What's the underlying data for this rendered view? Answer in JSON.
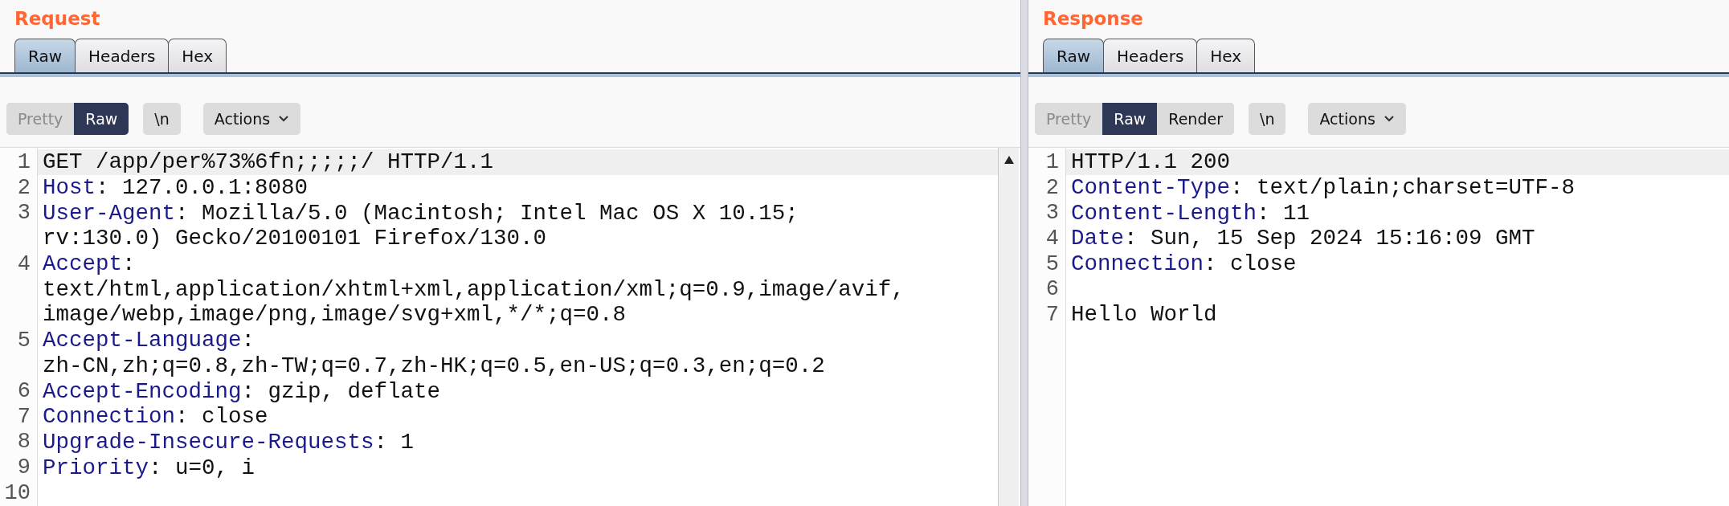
{
  "panes": [
    {
      "title": "Request",
      "tabs": [
        {
          "label": "Raw",
          "selected": true
        },
        {
          "label": "Headers",
          "selected": false
        },
        {
          "label": "Hex",
          "selected": false
        }
      ],
      "view_buttons": [
        {
          "label": "Pretty",
          "selected": false
        },
        {
          "label": "Raw",
          "selected": true
        }
      ],
      "newline_button": "\\n",
      "actions_button": "Actions",
      "scrollbar": true,
      "rows": [
        {
          "number": "1",
          "key": "",
          "text": "GET /app/per%73%6fn;;;;;/ HTTP/1.1",
          "current": true
        },
        {
          "number": "2",
          "key": "Host",
          "text": ": 127.0.0.1:8080",
          "current": false
        },
        {
          "number": "3",
          "key": "User-Agent",
          "text": ": Mozilla/5.0 (Macintosh; Intel Mac OS X 10.15;",
          "current": false
        },
        {
          "number": "",
          "key": "",
          "text": "rv:130.0) Gecko/20100101 Firefox/130.0",
          "current": false
        },
        {
          "number": "4",
          "key": "Accept",
          "text": ":",
          "current": false
        },
        {
          "number": "",
          "key": "",
          "text": "text/html,application/xhtml+xml,application/xml;q=0.9,image/avif,",
          "current": false
        },
        {
          "number": "",
          "key": "",
          "text": "image/webp,image/png,image/svg+xml,*/*;q=0.8",
          "current": false
        },
        {
          "number": "5",
          "key": "Accept-Language",
          "text": ":",
          "current": false
        },
        {
          "number": "",
          "key": "",
          "text": "zh-CN,zh;q=0.8,zh-TW;q=0.7,zh-HK;q=0.5,en-US;q=0.3,en;q=0.2",
          "current": false
        },
        {
          "number": "6",
          "key": "Accept-Encoding",
          "text": ": gzip, deflate",
          "current": false
        },
        {
          "number": "7",
          "key": "Connection",
          "text": ": close",
          "current": false
        },
        {
          "number": "8",
          "key": "Upgrade-Insecure-Requests",
          "text": ": 1",
          "current": false
        },
        {
          "number": "9",
          "key": "Priority",
          "text": ": u=0, i",
          "current": false
        },
        {
          "number": "10",
          "key": "",
          "text": "",
          "current": false
        }
      ]
    },
    {
      "title": "Response",
      "tabs": [
        {
          "label": "Raw",
          "selected": true
        },
        {
          "label": "Headers",
          "selected": false
        },
        {
          "label": "Hex",
          "selected": false
        }
      ],
      "view_buttons": [
        {
          "label": "Pretty",
          "selected": false
        },
        {
          "label": "Raw",
          "selected": true
        },
        {
          "label": "Render",
          "selected": false
        }
      ],
      "newline_button": "\\n",
      "actions_button": "Actions",
      "scrollbar": false,
      "rows": [
        {
          "number": "1",
          "key": "",
          "text": "HTTP/1.1 200",
          "current": true
        },
        {
          "number": "2",
          "key": "Content-Type",
          "text": ": text/plain;charset=UTF-8",
          "current": false
        },
        {
          "number": "3",
          "key": "Content-Length",
          "text": ": 11",
          "current": false
        },
        {
          "number": "4",
          "key": "Date",
          "text": ": Sun, 15 Sep 2024 15:16:09 GMT",
          "current": false
        },
        {
          "number": "5",
          "key": "Connection",
          "text": ": close",
          "current": false
        },
        {
          "number": "6",
          "key": "",
          "text": "",
          "current": false
        },
        {
          "number": "7",
          "key": "",
          "text": "Hello World",
          "current": false
        }
      ]
    }
  ]
}
